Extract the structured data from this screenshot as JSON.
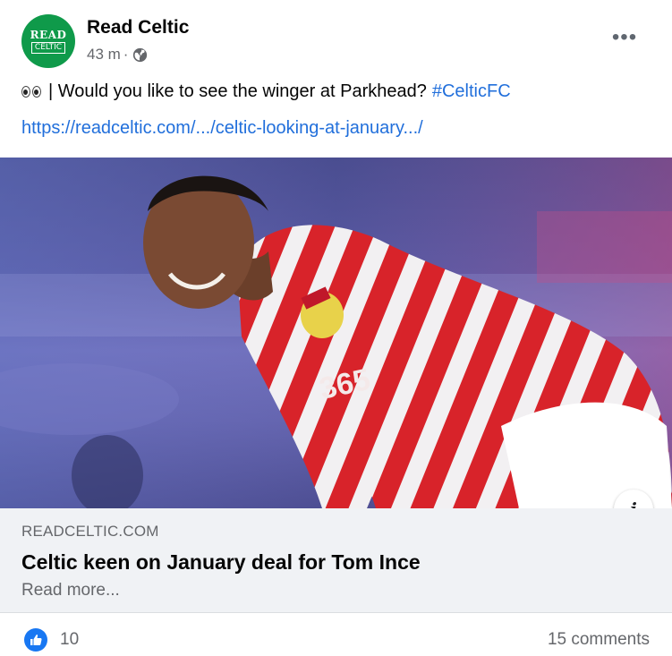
{
  "header": {
    "avatar_top": "READ",
    "avatar_bottom": "CELTIC",
    "page_name": "Read Celtic",
    "time": "43 m",
    "separator": "·",
    "audience_icon": "globe-icon",
    "more_label": "•••"
  },
  "post": {
    "emoji": "eyes-emoji",
    "text": "| Would you like to see the winger at Parkhead?",
    "hashtag": "#CelticFC",
    "link": "https://readceltic.com/.../celtic-looking-at-january.../"
  },
  "image": {
    "info_label": "i"
  },
  "preview": {
    "domain": "READCELTIC.COM",
    "headline": "Celtic keen on January deal for Tom Ince",
    "read_more": "Read more..."
  },
  "footer": {
    "reaction_icon": "like-icon",
    "like_count": "10",
    "comments": "15 comments"
  },
  "colors": {
    "brand_green": "#0f9a4a",
    "link_blue": "#216fdb",
    "like_blue": "#1877f2",
    "preview_bg": "#f0f2f5",
    "secondary_text": "#65676b"
  }
}
